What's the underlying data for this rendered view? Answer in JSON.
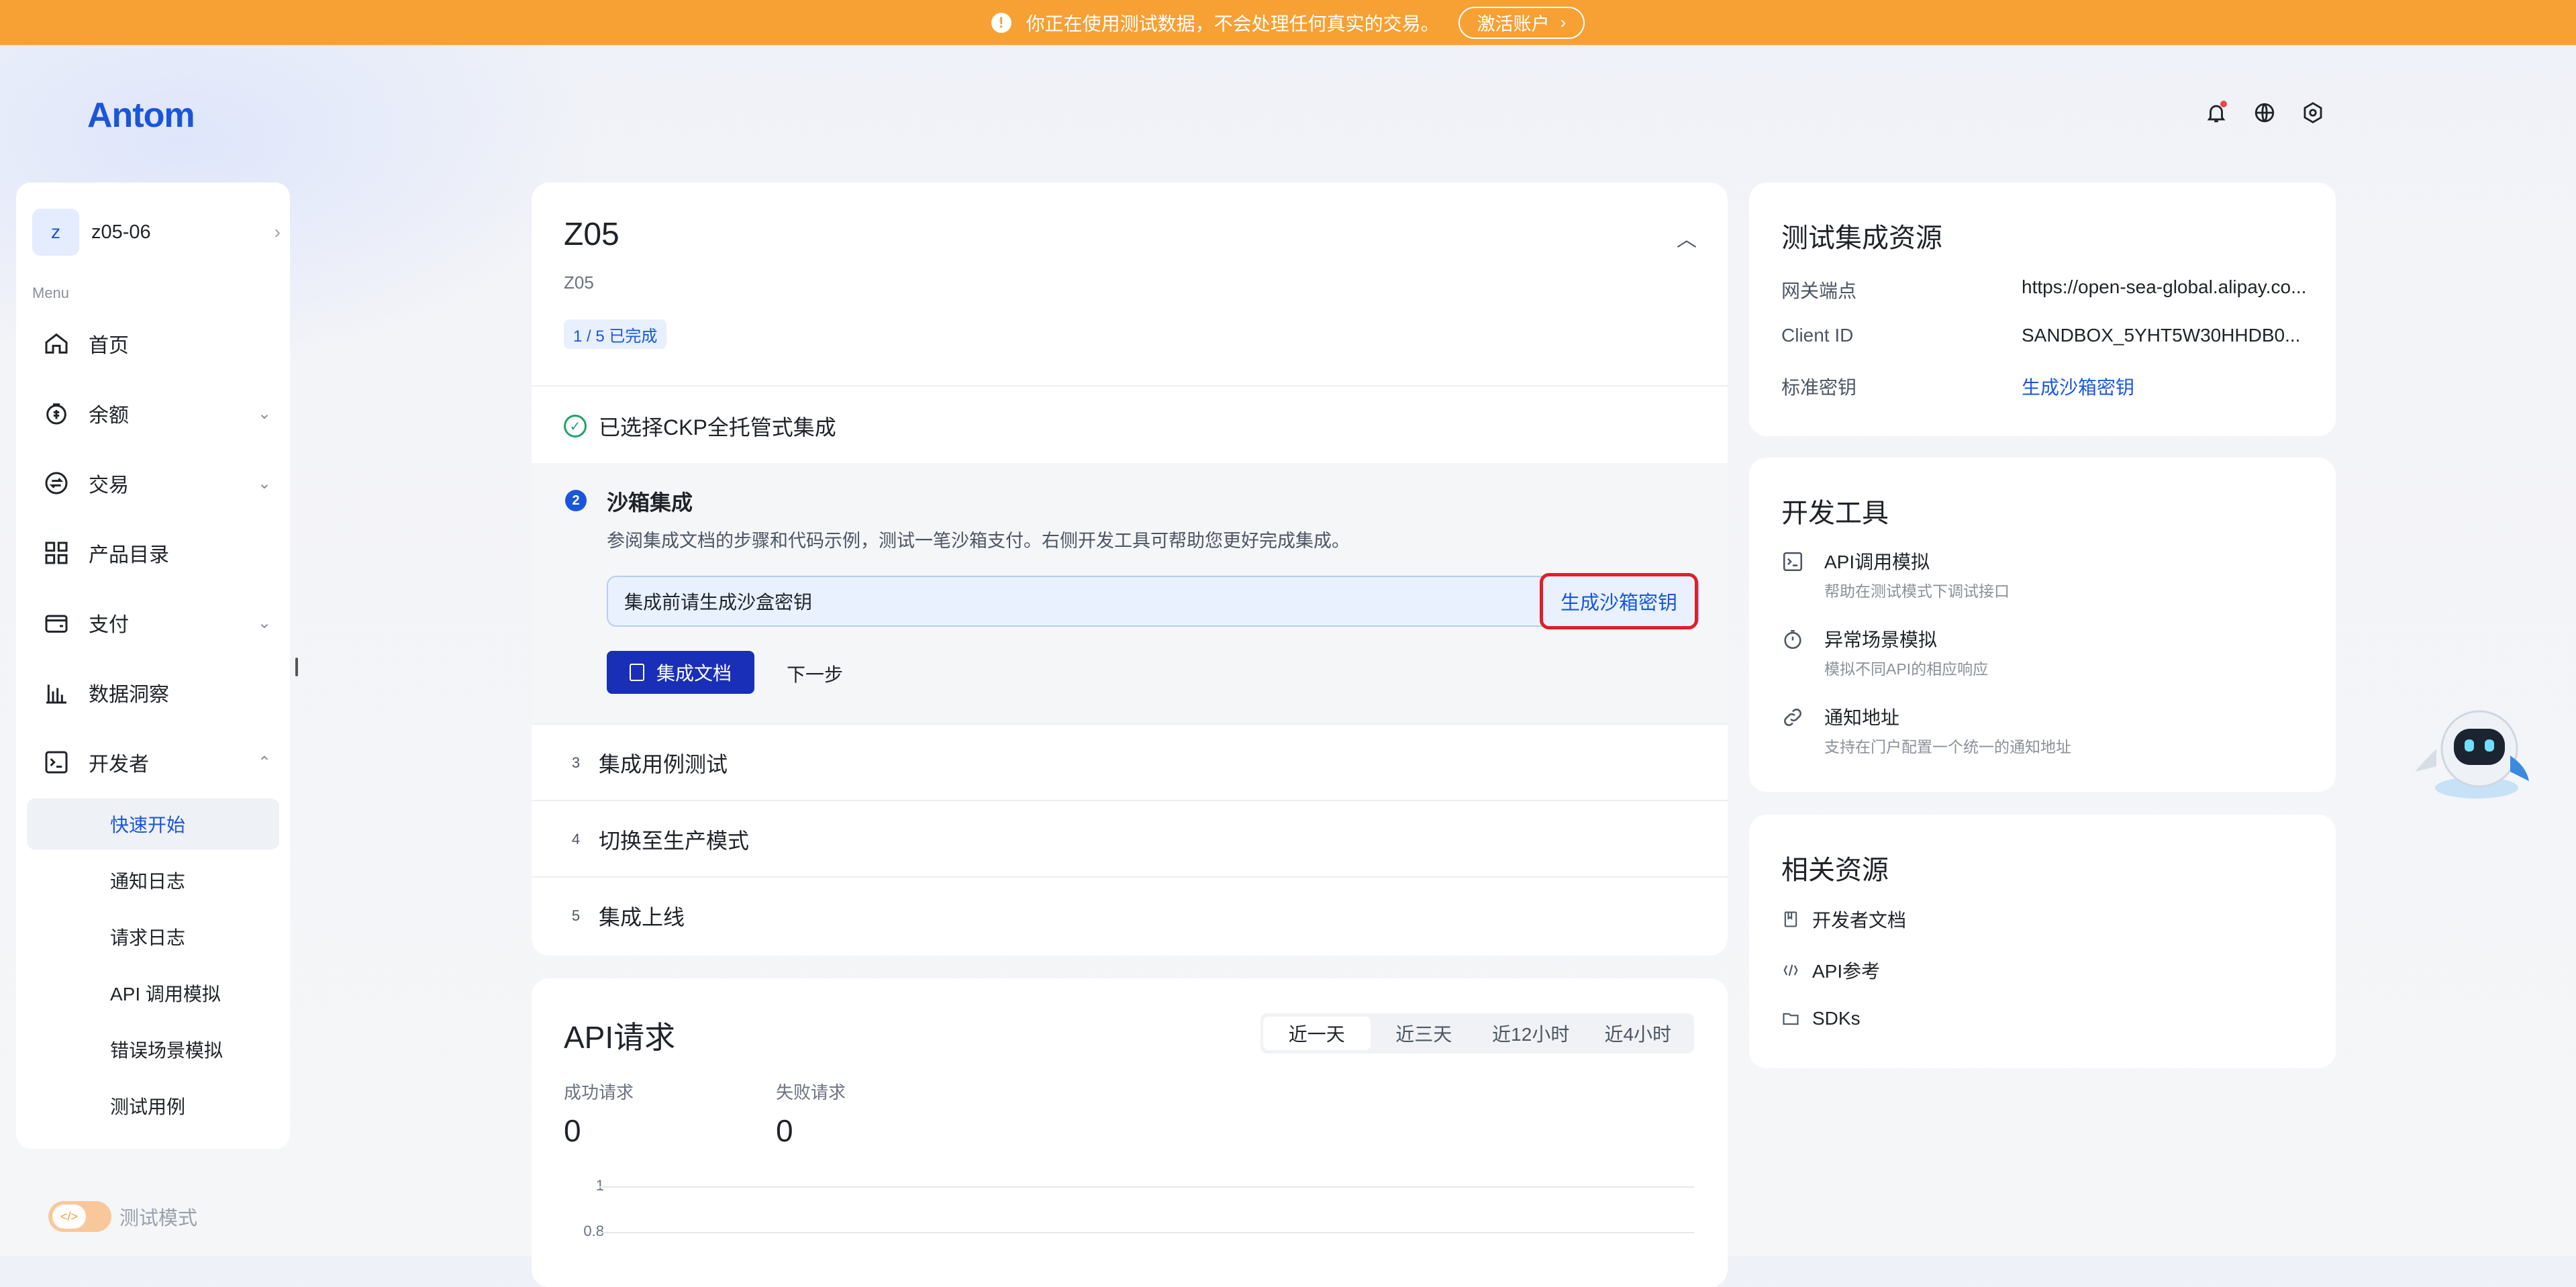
{
  "banner": {
    "text": "你正在使用测试数据，不会处理任何真实的交易。",
    "activate_label": "激活账户"
  },
  "brand": {
    "logo": "Antom"
  },
  "header_icons": [
    "bell-icon",
    "globe-icon",
    "settings-icon"
  ],
  "account": {
    "avatar": "z",
    "name": "z05-06"
  },
  "menu_caption": "Menu",
  "nav": [
    {
      "label": "首页",
      "icon": "home-icon"
    },
    {
      "label": "余额",
      "icon": "wallet-icon"
    },
    {
      "label": "交易",
      "icon": "exchange-icon"
    },
    {
      "label": "产品目录",
      "icon": "grid-icon"
    },
    {
      "label": "支付",
      "icon": "card-icon"
    },
    {
      "label": "数据洞察",
      "icon": "chart-icon"
    },
    {
      "label": "开发者",
      "icon": "terminal-icon"
    }
  ],
  "developer_sub": [
    "快速开始",
    "通知日志",
    "请求日志",
    "API 调用模拟",
    "错误场景模拟",
    "测试用例"
  ],
  "test_mode_label": "测试模式",
  "integration": {
    "title": "Z05",
    "subtitle": "Z05",
    "progress_badge": "1 / 5 已完成",
    "step1": "已选择CKP全托管式集成",
    "step2": {
      "num": "2",
      "title": "沙箱集成",
      "desc": "参阅集成文档的步骤和代码示例，测试一笔沙箱支付。右侧开发工具可帮助您更好完成集成。",
      "key_placeholder": "集成前请生成沙盒密钥",
      "generate_label": "生成沙箱密钥",
      "docs_label": "集成文档",
      "next_label": "下一步"
    },
    "steps": [
      {
        "num": "3",
        "label": "集成用例测试"
      },
      {
        "num": "4",
        "label": "切换至生产模式"
      },
      {
        "num": "5",
        "label": "集成上线"
      }
    ]
  },
  "api_requests": {
    "title": "API请求",
    "ranges": [
      "近一天",
      "近三天",
      "近12小时",
      "近4小时"
    ],
    "selected_range": "近一天",
    "success_label": "成功请求",
    "success_value": "0",
    "fail_label": "失败请求",
    "fail_value": "0",
    "y_ticks": [
      "1",
      "0.8"
    ]
  },
  "test_resources": {
    "title": "测试集成资源",
    "gateway_label": "网关端点",
    "gateway_value": "https://open-sea-global.alipay.co...",
    "client_label": "Client ID",
    "client_value": "SANDBOX_5YHT5W30HHDB0...",
    "key_label": "标准密钥",
    "key_link": "生成沙箱密钥"
  },
  "dev_tools": {
    "title": "开发工具",
    "items": [
      {
        "title": "API调用模拟",
        "desc": "帮助在测试模式下调试接口"
      },
      {
        "title": "异常场景模拟",
        "desc": "模拟不同API的相应响应"
      },
      {
        "title": "通知地址",
        "desc": "支持在门户配置一个统一的通知地址"
      }
    ]
  },
  "related": {
    "title": "相关资源",
    "items": [
      "开发者文档",
      "API参考",
      "SDKs"
    ]
  },
  "colors": {
    "accent": "#1a56db",
    "banner": "#f7a033",
    "highlight": "#e11d2a",
    "success": "#22a06b"
  }
}
